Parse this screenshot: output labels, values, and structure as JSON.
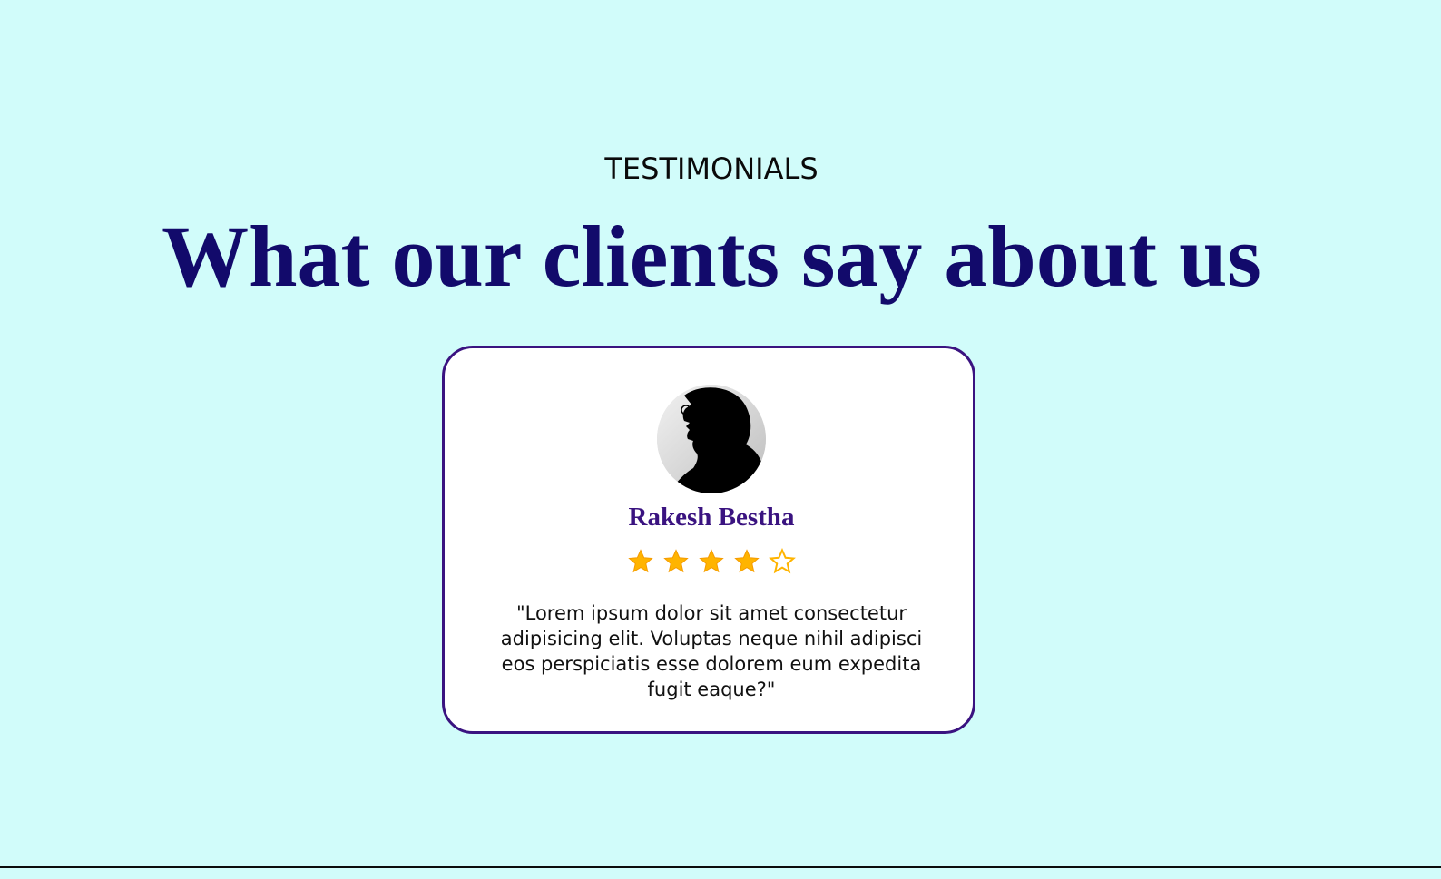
{
  "section": {
    "eyebrow": "TESTIMONIALS",
    "headline": "What our clients say about us"
  },
  "testimonial": {
    "avatar_icon": "person-silhouette-avatar",
    "name": "Rakesh Bestha",
    "rating": 4,
    "rating_max": 5,
    "quote": "\"Lorem ipsum dolor sit amet consectetur adipisicing elit. Voluptas neque nihil adipisci eos perspiciatis esse dolorem eum expedita fugit eaque?\""
  },
  "colors": {
    "background": "#d1fcfa",
    "headline": "#120a6b",
    "card_border": "#3a1380",
    "name": "#3a1380",
    "star": "#ffb400"
  }
}
